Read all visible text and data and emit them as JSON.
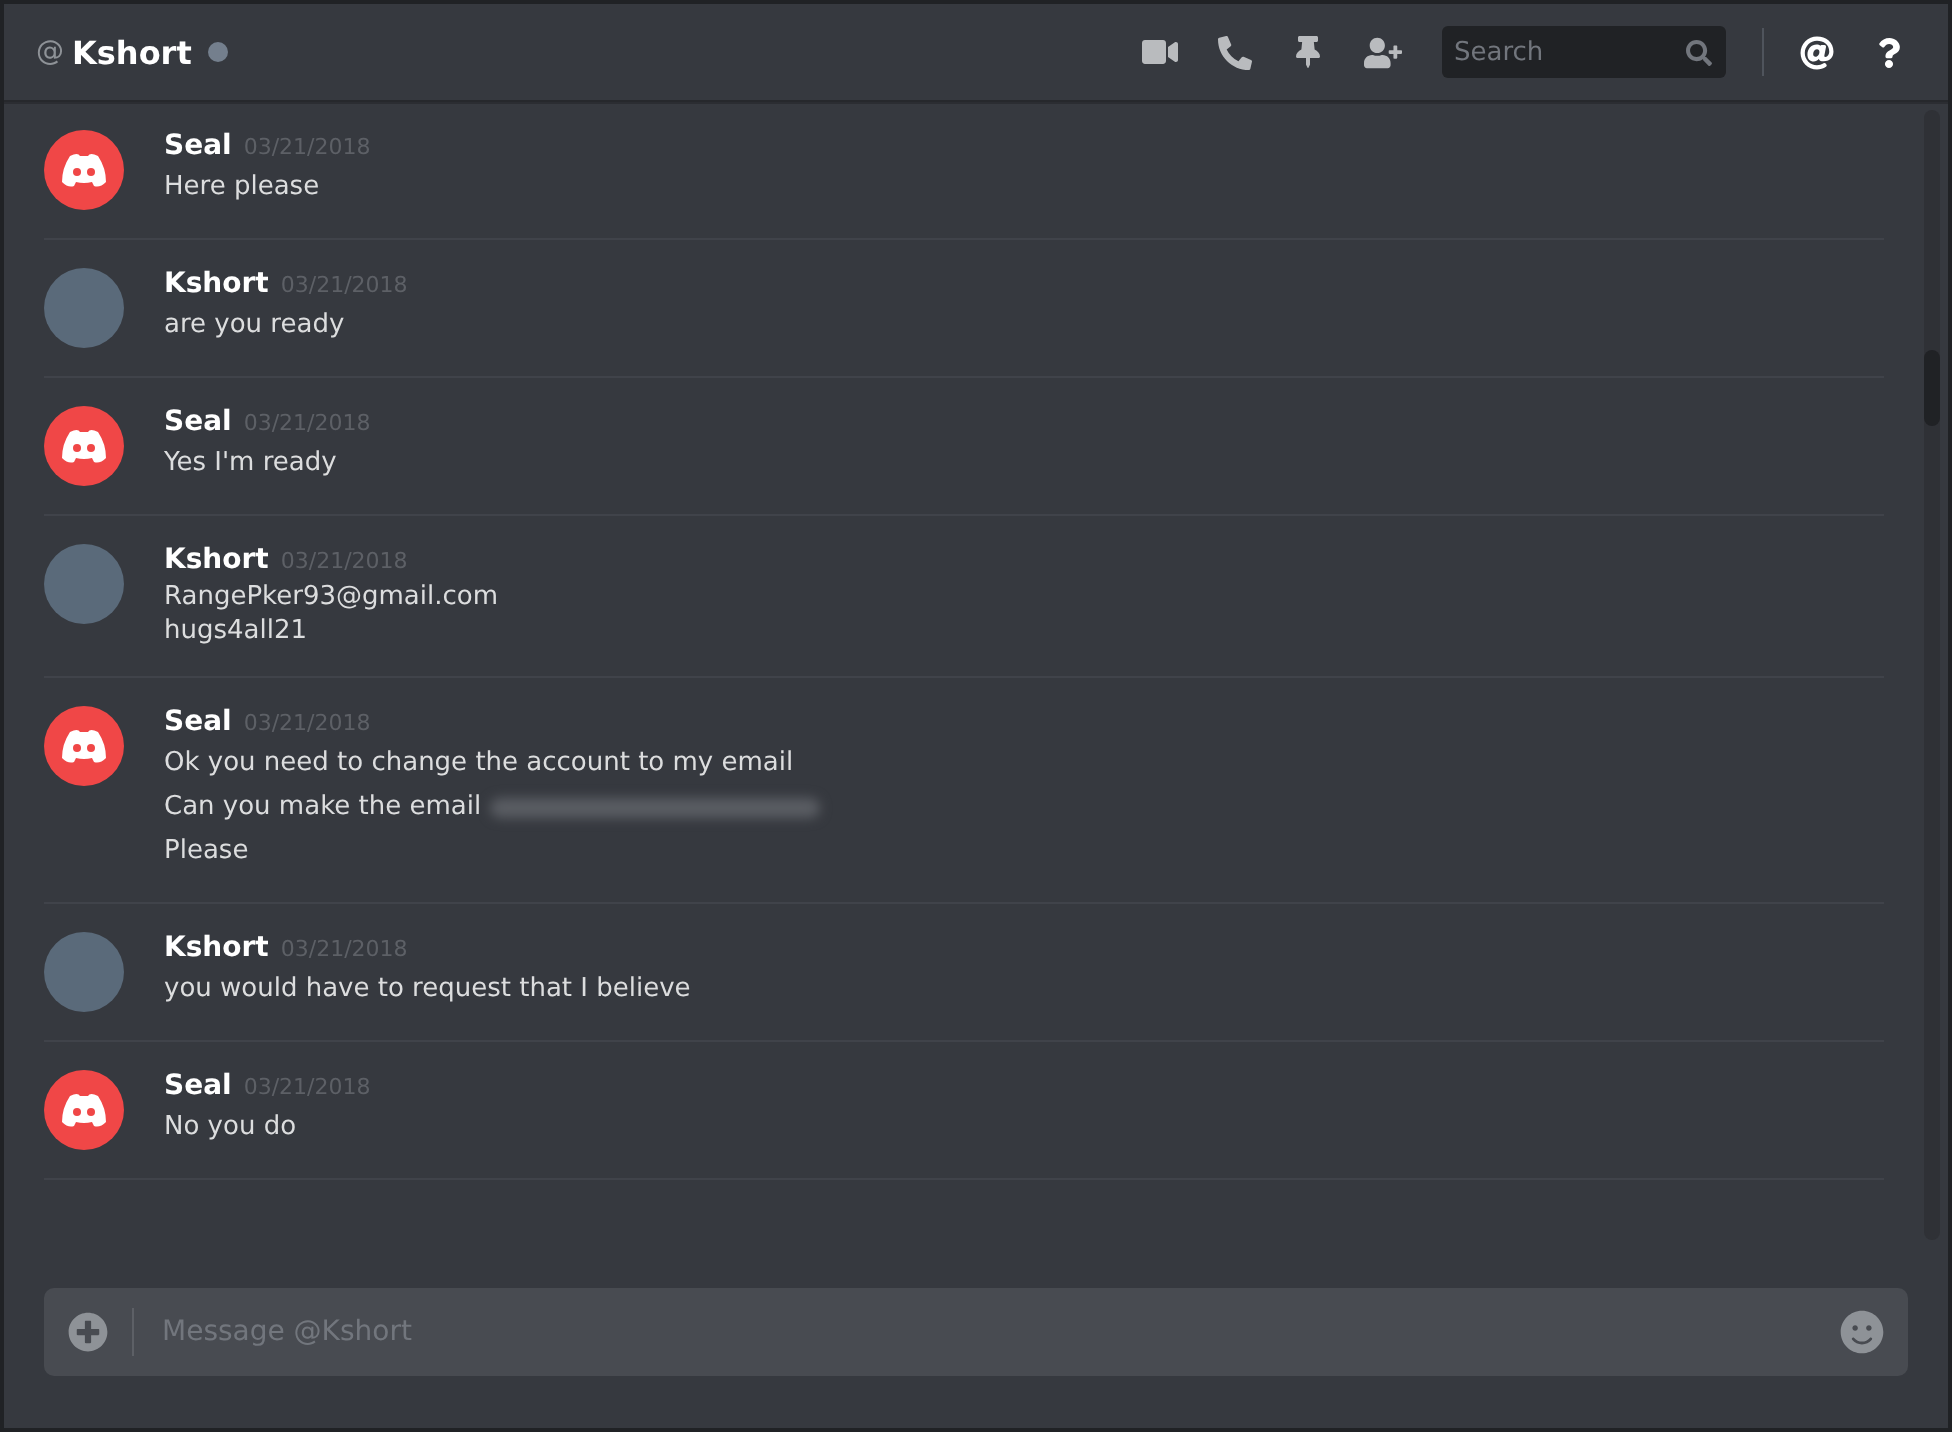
{
  "header": {
    "at_sign": "@",
    "username": "Kshort",
    "online": false,
    "search": {
      "placeholder": "Search"
    }
  },
  "messages": [
    {
      "author": "Seal",
      "kind": "logo",
      "timestamp": "03/21/2018",
      "lines": [
        {
          "text": "Here please"
        }
      ]
    },
    {
      "author": "Kshort",
      "kind": "photo",
      "timestamp": "03/21/2018",
      "lines": [
        {
          "text": "are you ready"
        }
      ]
    },
    {
      "author": "Seal",
      "kind": "logo",
      "timestamp": "03/21/2018",
      "lines": [
        {
          "text": "Yes I'm ready"
        }
      ]
    },
    {
      "author": "Kshort",
      "kind": "photo",
      "timestamp": "03/21/2018",
      "lines": [
        {
          "text": "RangePker93@gmail.com\nhugs4all21"
        }
      ]
    },
    {
      "author": "Seal",
      "kind": "logo",
      "timestamp": "03/21/2018",
      "lines": [
        {
          "text": "Ok you need to change the account to my email"
        },
        {
          "text": "Can you make the email",
          "redacted": true
        },
        {
          "text": "Please"
        }
      ]
    },
    {
      "author": "Kshort",
      "kind": "photo",
      "timestamp": "03/21/2018",
      "lines": [
        {
          "text": "you would have to request that I believe"
        }
      ]
    },
    {
      "author": "Seal",
      "kind": "logo",
      "timestamp": "03/21/2018",
      "lines": [
        {
          "text": "No you do"
        }
      ]
    }
  ],
  "composer": {
    "placeholder": "Message @Kshort"
  }
}
